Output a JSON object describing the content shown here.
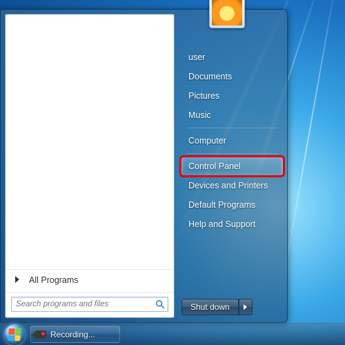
{
  "start_menu": {
    "all_programs_label": "All Programs",
    "search": {
      "placeholder": "Search programs and files"
    },
    "right_items": [
      {
        "label": "user"
      },
      {
        "label": "Documents"
      },
      {
        "label": "Pictures"
      },
      {
        "label": "Music"
      },
      {
        "separator": true
      },
      {
        "label": "Computer"
      },
      {
        "separator": true
      },
      {
        "label": "Control Panel",
        "highlighted": true,
        "annotated": true
      },
      {
        "label": "Devices and Printers"
      },
      {
        "label": "Default Programs"
      },
      {
        "label": "Help and Support"
      }
    ],
    "shutdown_label": "Shut down"
  },
  "taskbar": {
    "items": [
      {
        "label": "Recording...",
        "icon": "camera"
      }
    ]
  },
  "annotation": {
    "color": "#e60000"
  }
}
